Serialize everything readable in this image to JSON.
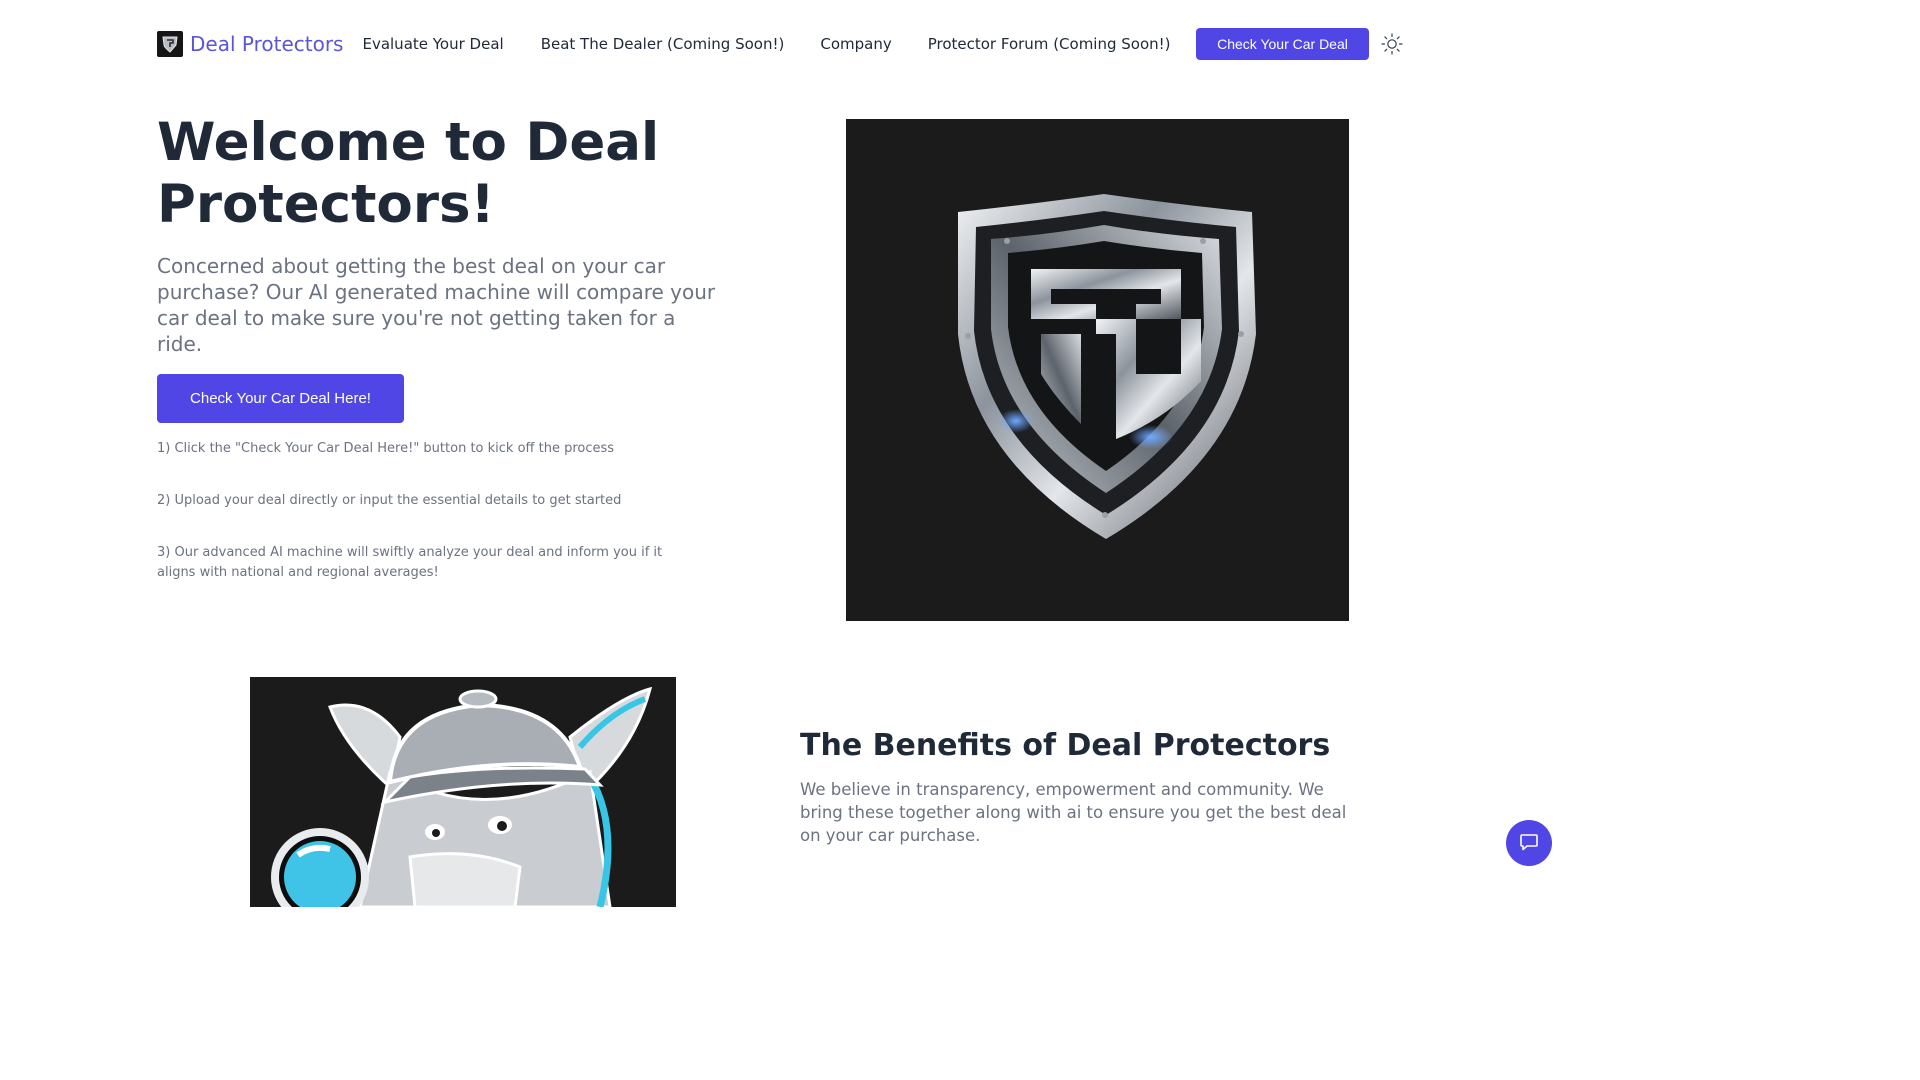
{
  "nav": {
    "brand": "Deal Protectors",
    "links": [
      "Evaluate Your Deal",
      "Beat The Dealer (Coming Soon!)",
      "Company",
      "Protector Forum (Coming Soon!)"
    ],
    "cta": "Check Your Car Deal",
    "theme_icon": "sun-icon"
  },
  "hero": {
    "title": "Welcome to Deal Protectors!",
    "subtitle": "Concerned about getting the best deal on your car purchase? Our AI generated machine will compare your car deal to make sure you're not getting taken for a ride.",
    "cta": "Check Your Car Deal Here!",
    "steps": [
      "1) Click the \"Check Your Car Deal Here!\" button to kick off the process",
      "2) Upload your deal directly or input the essential details to get started",
      "3) Our advanced AI machine will swiftly analyze your deal and inform you if it aligns with national and regional averages!"
    ]
  },
  "benefits": {
    "title": "The Benefits of Deal Protectors",
    "text": "We believe in transparency, empowerment and community. We bring these together along with ai to ensure you get the best deal on your car purchase."
  },
  "colors": {
    "accent": "#4f46e5",
    "brand_text": "#5a56d6",
    "heading": "#1f2937",
    "muted": "#6b7280",
    "image_bg": "#1b1b1b"
  },
  "icons": {
    "chat": "chat-bubble-icon",
    "brand_logo": "shield-logo-icon"
  }
}
